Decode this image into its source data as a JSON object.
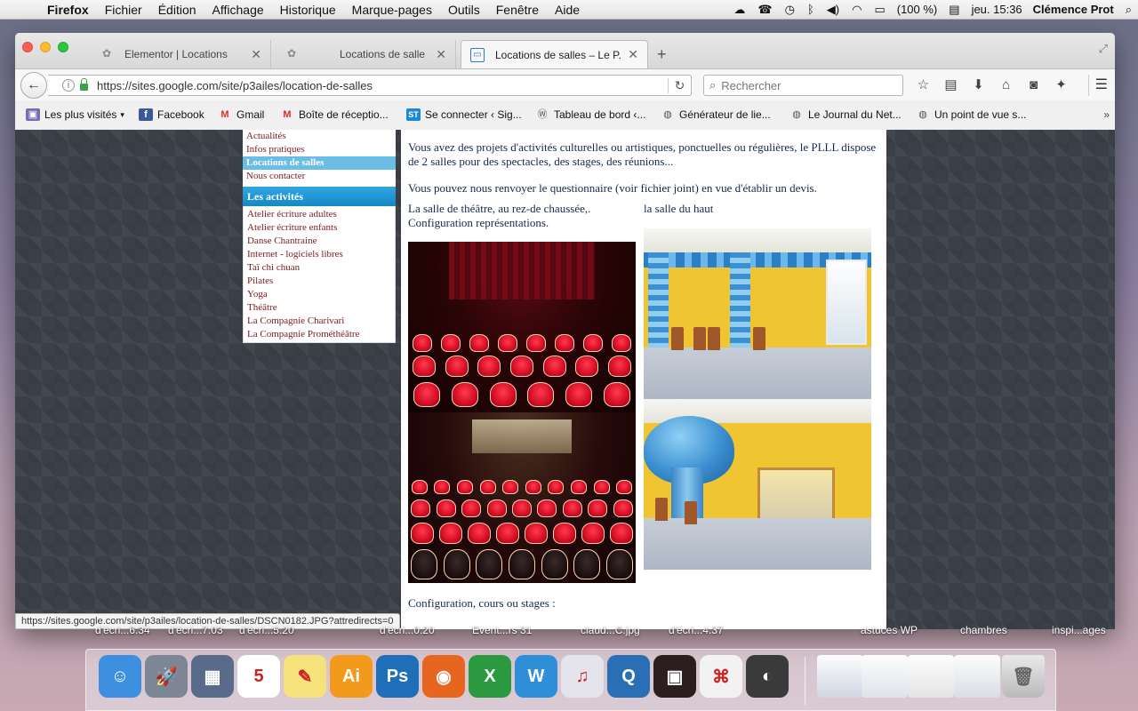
{
  "menubar": {
    "apple": "",
    "items": [
      "Firefox",
      "Fichier",
      "Édition",
      "Affichage",
      "Historique",
      "Marque-pages",
      "Outils",
      "Fenêtre",
      "Aide"
    ],
    "battery": "(100 %)",
    "clock": "jeu. 15:36",
    "user": "Clémence Prot"
  },
  "tabs": [
    {
      "title": "Elementor | Locations",
      "active": false
    },
    {
      "title": "Locations de salle",
      "active": false
    },
    {
      "title": "Locations de salles – Le P...",
      "active": true
    }
  ],
  "navbar": {
    "url": "https://sites.google.com/site/p3ailes/location-de-salles",
    "search_placeholder": "Rechercher"
  },
  "bookmarks": [
    {
      "label": "Les plus visités",
      "icon": "folder-icon",
      "dropdown": true
    },
    {
      "label": "Facebook",
      "icon": "facebook-icon"
    },
    {
      "label": "Gmail",
      "icon": "gmail-icon"
    },
    {
      "label": "Boîte de réceptio...",
      "icon": "gmail-icon"
    },
    {
      "label": "Se connecter ‹ Sig...",
      "icon": "st-icon"
    },
    {
      "label": "Tableau de bord ‹...",
      "icon": "wordpress-icon"
    },
    {
      "label": "Générateur de lie...",
      "icon": "globe-icon"
    },
    {
      "label": "Le Journal du Net...",
      "icon": "globe-icon"
    },
    {
      "label": "Un point de vue s...",
      "icon": "globe-icon"
    }
  ],
  "sidebar": {
    "top_links": [
      "Actualités",
      "Infos pratiques",
      "Locations de salles",
      "Nous contacter"
    ],
    "selected_index": 2,
    "activities_header": "Les activités",
    "activities": [
      "Atelier écriture adultes",
      "Atelier écriture enfants",
      "Danse Chantraine",
      "Internet - logiciels libres",
      "Taï chi chuan",
      "Pilates",
      "Yoga",
      "Théâtre",
      "La Compagnie Charivari",
      "La Compagnie Prométhéâtre"
    ]
  },
  "content": {
    "intro": "Vous avez des projets d'activités culturelles ou artistiques, ponctuelles ou régulières, le PLLL dispose de 2 salles pour des spectacles, des stages, des réunions...",
    "devis": "Vous pouvez nous renvoyer le questionnaire (voir fichier joint) en vue d'établir un devis.",
    "theatre_label_1": "La salle de théâtre, au rez-de chaussée,.",
    "theatre_label_2": "Configuration représentations.",
    "haut_label": "la salle du haut",
    "config_label": "Configuration, cours ou stages :"
  },
  "status_url": "https://sites.google.com/site/p3ailes/location-de-salles/DSCN0182.JPG?attredirects=0",
  "desktop_labels": [
    "d'écri...6.34",
    "d'écri...7.03",
    "d'écri...5.20",
    "d'écri...0.20",
    "Event...rs 31",
    "claud...C.jpg",
    "d'écri...4.37",
    "astuces WP",
    "chambres",
    "inspi...ages"
  ],
  "dock": [
    {
      "name": "finder-icon",
      "color": "#3d8fe0",
      "glyph": "☺"
    },
    {
      "name": "launchpad-icon",
      "color": "#7d8694",
      "glyph": "🚀"
    },
    {
      "name": "photo-browser-icon",
      "color": "#5a6a8a",
      "glyph": "▦"
    },
    {
      "name": "calendar-icon",
      "color": "#ffffff",
      "glyph": "5"
    },
    {
      "name": "stickies-icon",
      "color": "#f6e27a",
      "glyph": "✎"
    },
    {
      "name": "illustrator-icon",
      "color": "#f39a1d",
      "glyph": "Ai"
    },
    {
      "name": "photoshop-icon",
      "color": "#1f6fb8",
      "glyph": "Ps"
    },
    {
      "name": "firefox-icon",
      "color": "#e8651f",
      "glyph": "◉"
    },
    {
      "name": "excel-icon",
      "color": "#2b9a3e",
      "glyph": "X"
    },
    {
      "name": "word-icon",
      "color": "#2f8ed8",
      "glyph": "W"
    },
    {
      "name": "itunes-icon",
      "color": "#e4e4ea",
      "glyph": "♫"
    },
    {
      "name": "quicktime-icon",
      "color": "#2a6fb5",
      "glyph": "Q"
    },
    {
      "name": "indesign-icon",
      "color": "#2c1e1e",
      "glyph": "▣"
    },
    {
      "name": "acrobat-icon",
      "color": "#f2f2f2",
      "glyph": "⌘"
    },
    {
      "name": "mamp-icon",
      "color": "#3a3a3a",
      "glyph": "◐"
    }
  ],
  "colors": {
    "nav_selected": "#6bbde6",
    "section_header": "#1f95d4",
    "link": "#7a1a1a",
    "body_text": "#13284f"
  }
}
